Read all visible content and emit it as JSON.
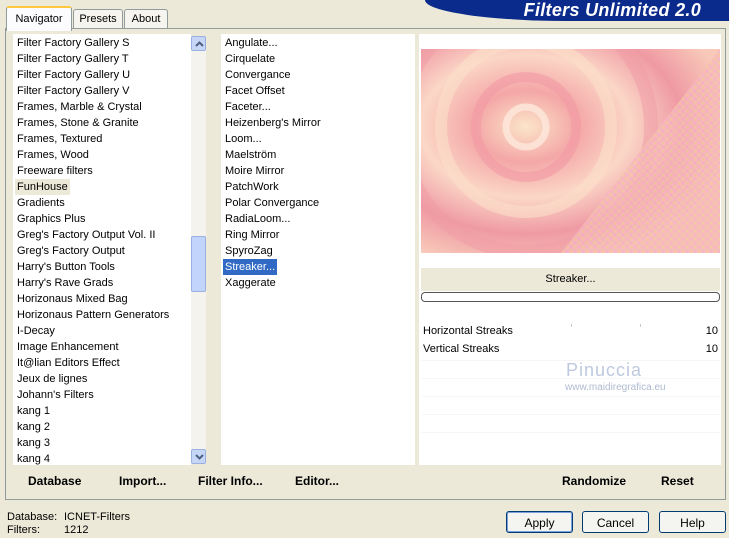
{
  "tabs": [
    {
      "label": "Navigator",
      "active": true
    },
    {
      "label": "Presets",
      "active": false
    },
    {
      "label": "About",
      "active": false
    }
  ],
  "banner": {
    "title": "Filters Unlimited 2.0"
  },
  "categories": [
    "Filter Factory Gallery S",
    "Filter Factory Gallery T",
    "Filter Factory Gallery U",
    "Filter Factory Gallery V",
    "Frames, Marble & Crystal",
    "Frames, Stone & Granite",
    "Frames, Textured",
    "Frames, Wood",
    "Freeware filters",
    "FunHouse",
    "Gradients",
    "Graphics Plus",
    "Greg's Factory Output Vol. II",
    "Greg's Factory Output",
    "Harry's Button Tools",
    "Harry's Rave Grads",
    "Horizonaus Mixed Bag",
    "Horizonaus Pattern Generators",
    "I-Decay",
    "Image Enhancement",
    "It@lian Editors Effect",
    "Jeux de lignes",
    "Johann's Filters",
    "kang 1",
    "kang 2",
    "kang 3",
    "kang 4"
  ],
  "selected_category": "FunHouse",
  "filters": [
    "Angulate...",
    "Cirquelate",
    "Convergance",
    "Facet Offset",
    "Faceter...",
    "Heizenberg's Mirror",
    "Loom...",
    "Maelström",
    "Moire Mirror",
    "PatchWork",
    "Polar Convergance",
    "RadiaLoom...",
    "Ring Mirror",
    "SpyroZag",
    "Streaker...",
    "Xaggerate"
  ],
  "selected_filter": "Streaker...",
  "preview": {
    "filter_name": "Streaker...",
    "progress": 0
  },
  "params": [
    {
      "label": "Horizontal Streaks",
      "value": "10"
    },
    {
      "label": "Vertical Streaks",
      "value": "10"
    }
  ],
  "watermark": {
    "line1": "Pinuccia",
    "line2": "www.maidiregrafica.eu"
  },
  "left_buttons": {
    "database": "Database",
    "import": "Import...",
    "filter_info": "Filter Info...",
    "editor": "Editor..."
  },
  "right_buttons": {
    "randomize": "Randomize",
    "reset": "Reset"
  },
  "status": {
    "database_label": "Database:",
    "database_value": "ICNET-Filters",
    "filters_label": "Filters:",
    "filters_value": "1212"
  },
  "dialog_buttons": {
    "apply": "Apply",
    "cancel": "Cancel",
    "help": "Help"
  },
  "colors": {
    "banner": "#0a2a8c",
    "selection": "#316ac5",
    "preview_pink": "#f2a0a0"
  }
}
